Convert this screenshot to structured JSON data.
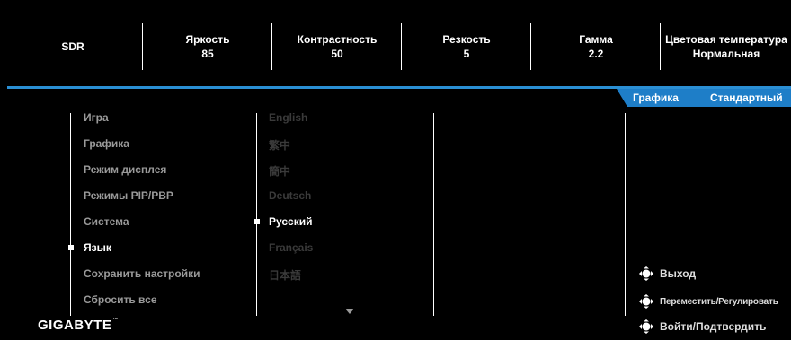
{
  "header": {
    "items": [
      {
        "label": "SDR",
        "value": ""
      },
      {
        "label": "Яркость",
        "value": "85"
      },
      {
        "label": "Контрастность",
        "value": "50"
      },
      {
        "label": "Резкость",
        "value": "5"
      },
      {
        "label": "Гамма",
        "value": "2.2"
      },
      {
        "label": "Цветовая температура",
        "value": "Нормальная"
      }
    ]
  },
  "tabs": {
    "mode": "Графика",
    "preset": "Стандартный"
  },
  "menu": {
    "items": [
      {
        "label": "Игра"
      },
      {
        "label": "Графика"
      },
      {
        "label": "Режим дисплея"
      },
      {
        "label": "Режимы PIP/PBP"
      },
      {
        "label": "Система"
      },
      {
        "label": "Язык"
      },
      {
        "label": "Сохранить настройки"
      },
      {
        "label": "Сбросить все"
      }
    ],
    "selected": "Язык"
  },
  "languages": {
    "items": [
      {
        "label": "English"
      },
      {
        "label": "繁中"
      },
      {
        "label": "簡中"
      },
      {
        "label": "Deutsch"
      },
      {
        "label": "Русский"
      },
      {
        "label": "Français"
      },
      {
        "label": "日本語"
      }
    ],
    "selected": "Русский",
    "more_icon": "chevron-down-icon"
  },
  "hints": {
    "exit": "Выход",
    "move": "Переместить/Регулировать",
    "enter": "Войти/Подтвердить",
    "icon": "joystick-icon"
  },
  "logo": {
    "text": "GIGABYTE",
    "mark": "™"
  },
  "colors": {
    "accent": "#1e7ec8",
    "background": "#000000",
    "active_text": "#ffffff",
    "inactive_text": "#9a9a9a",
    "disabled_text": "#3a3a3a"
  }
}
